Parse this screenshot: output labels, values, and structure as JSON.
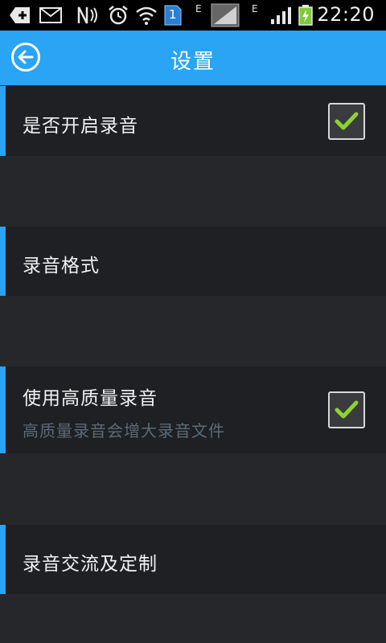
{
  "status_bar": {
    "time": "22:20",
    "sim_badge": "1",
    "network_labels": [
      "E",
      "E"
    ],
    "icons": [
      "add-notification-icon",
      "mail-icon",
      "nfc-icon",
      "alarm-clock-icon",
      "wifi-icon",
      "sim-card-icon",
      "signal-icon",
      "signal-icon",
      "battery-charging-icon"
    ]
  },
  "app_bar": {
    "title": "设置",
    "back_icon": "back-arrow-icon",
    "color": "#2aa4f4"
  },
  "settings": {
    "items": [
      {
        "title": "是否开启录音",
        "checked": true
      },
      {
        "title": "录音格式"
      },
      {
        "title": "使用高质量录音",
        "summary": "高质量录音会增大录音文件",
        "checked": true
      },
      {
        "title": "录音交流及定制"
      }
    ]
  },
  "colors": {
    "accent": "#2aa4f4",
    "check": "#8bd32f",
    "background": "#26272b",
    "row": "#1f2023"
  }
}
